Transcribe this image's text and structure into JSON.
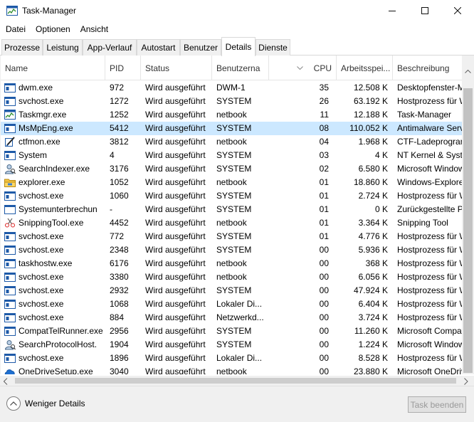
{
  "window": {
    "title": "Task-Manager"
  },
  "menu": [
    {
      "label": "Datei"
    },
    {
      "label": "Optionen"
    },
    {
      "label": "Ansicht"
    }
  ],
  "tabs": [
    {
      "label": "Prozesse"
    },
    {
      "label": "Leistung"
    },
    {
      "label": "App-Verlauf"
    },
    {
      "label": "Autostart"
    },
    {
      "label": "Benutzer"
    },
    {
      "label": "Details",
      "active": true
    },
    {
      "label": "Dienste"
    }
  ],
  "table": {
    "columns": {
      "name": "Name",
      "pid": "PID",
      "status": "Status",
      "user": "Benutzerna",
      "cpu": "CPU",
      "mem": "Arbeitsspei...",
      "desc": "Beschreibung"
    },
    "sort": {
      "column": "cpu",
      "direction": "descending"
    },
    "rows": [
      {
        "icon": "window-icon",
        "name": "dwm.exe",
        "pid": "972",
        "status": "Wird ausgeführt",
        "user": "DWM-1",
        "cpu": "35",
        "mem": "12.508 K",
        "desc": "Desktopfenster-Manager"
      },
      {
        "icon": "window-icon",
        "name": "svchost.exe",
        "pid": "1272",
        "status": "Wird ausgeführt",
        "user": "SYSTEM",
        "cpu": "26",
        "mem": "63.192 K",
        "desc": "Hostprozess für Windows-Dienste"
      },
      {
        "icon": "taskmgr-icon",
        "name": "Taskmgr.exe",
        "pid": "1252",
        "status": "Wird ausgeführt",
        "user": "netbook",
        "cpu": "11",
        "mem": "12.188 K",
        "desc": "Task-Manager"
      },
      {
        "icon": "window-icon",
        "name": "MsMpEng.exe",
        "pid": "5412",
        "status": "Wird ausgeführt",
        "user": "SYSTEM",
        "cpu": "08",
        "mem": "110.052 K",
        "desc": "Antimalware Service Executable",
        "selected": true
      },
      {
        "icon": "pen-icon",
        "name": "ctfmon.exe",
        "pid": "3812",
        "status": "Wird ausgeführt",
        "user": "netbook",
        "cpu": "04",
        "mem": "1.968 K",
        "desc": "CTF-Ladeprogramm"
      },
      {
        "icon": "window-icon",
        "name": "System",
        "pid": "4",
        "status": "Wird ausgeführt",
        "user": "SYSTEM",
        "cpu": "03",
        "mem": "4 K",
        "desc": "NT Kernel & System"
      },
      {
        "icon": "person-icon",
        "name": "SearchIndexer.exe",
        "pid": "3176",
        "status": "Wird ausgeführt",
        "user": "SYSTEM",
        "cpu": "02",
        "mem": "6.580 K",
        "desc": "Microsoft Windows Search-Indexer"
      },
      {
        "icon": "folder-icon",
        "name": "explorer.exe",
        "pid": "1052",
        "status": "Wird ausgeführt",
        "user": "netbook",
        "cpu": "01",
        "mem": "18.860 K",
        "desc": "Windows-Explorer"
      },
      {
        "icon": "window-icon",
        "name": "svchost.exe",
        "pid": "1060",
        "status": "Wird ausgeführt",
        "user": "SYSTEM",
        "cpu": "01",
        "mem": "2.724 K",
        "desc": "Hostprozess für Windows-Dienste"
      },
      {
        "icon": "blank-window-icon",
        "name": "Systemunterbrechun",
        "pid": "-",
        "status": "Wird ausgeführt",
        "user": "SYSTEM",
        "cpu": "01",
        "mem": "0 K",
        "desc": "Zurückgestellte Prozeduraufrufe"
      },
      {
        "icon": "scissors-icon",
        "name": "SnippingTool.exe",
        "pid": "4452",
        "status": "Wird ausgeführt",
        "user": "netbook",
        "cpu": "01",
        "mem": "3.364 K",
        "desc": "Snipping Tool"
      },
      {
        "icon": "window-icon",
        "name": "svchost.exe",
        "pid": "772",
        "status": "Wird ausgeführt",
        "user": "SYSTEM",
        "cpu": "01",
        "mem": "4.776 K",
        "desc": "Hostprozess für Windows-Dienste"
      },
      {
        "icon": "window-icon",
        "name": "svchost.exe",
        "pid": "2348",
        "status": "Wird ausgeführt",
        "user": "SYSTEM",
        "cpu": "00",
        "mem": "5.936 K",
        "desc": "Hostprozess für Windows-Dienste"
      },
      {
        "icon": "window-icon",
        "name": "taskhostw.exe",
        "pid": "6176",
        "status": "Wird ausgeführt",
        "user": "netbook",
        "cpu": "00",
        "mem": "368 K",
        "desc": "Hostprozess für Windows-Aufgaben"
      },
      {
        "icon": "window-icon",
        "name": "svchost.exe",
        "pid": "3380",
        "status": "Wird ausgeführt",
        "user": "netbook",
        "cpu": "00",
        "mem": "6.056 K",
        "desc": "Hostprozess für Windows-Dienste"
      },
      {
        "icon": "window-icon",
        "name": "svchost.exe",
        "pid": "2932",
        "status": "Wird ausgeführt",
        "user": "SYSTEM",
        "cpu": "00",
        "mem": "47.924 K",
        "desc": "Hostprozess für Windows-Dienste"
      },
      {
        "icon": "window-icon",
        "name": "svchost.exe",
        "pid": "1068",
        "status": "Wird ausgeführt",
        "user": "Lokaler Di...",
        "cpu": "00",
        "mem": "6.404 K",
        "desc": "Hostprozess für Windows-Dienste"
      },
      {
        "icon": "window-icon",
        "name": "svchost.exe",
        "pid": "884",
        "status": "Wird ausgeführt",
        "user": "Netzwerkd...",
        "cpu": "00",
        "mem": "3.724 K",
        "desc": "Hostprozess für Windows-Dienste"
      },
      {
        "icon": "window-icon",
        "name": "CompatTelRunner.exe",
        "pid": "2956",
        "status": "Wird ausgeführt",
        "user": "SYSTEM",
        "cpu": "00",
        "mem": "11.260 K",
        "desc": "Microsoft Compatibility Telemetry"
      },
      {
        "icon": "person-icon",
        "name": "SearchProtocolHost.",
        "pid": "1904",
        "status": "Wird ausgeführt",
        "user": "SYSTEM",
        "cpu": "00",
        "mem": "1.224 K",
        "desc": "Microsoft Windows Search Protocol Host"
      },
      {
        "icon": "window-icon",
        "name": "svchost.exe",
        "pid": "1896",
        "status": "Wird ausgeführt",
        "user": "Lokaler Di...",
        "cpu": "00",
        "mem": "8.528 K",
        "desc": "Hostprozess für Windows-Dienste"
      },
      {
        "icon": "cloud-icon",
        "name": "OneDriveSetup.exe",
        "pid": "3040",
        "status": "Wird ausgeführt",
        "user": "netbook",
        "cpu": "00",
        "mem": "23.880 K",
        "desc": "Microsoft OneDrive Setup"
      }
    ]
  },
  "footer": {
    "fewer_details": "Weniger Details",
    "end_task": "Task beenden",
    "end_task_enabled": false
  },
  "colors": {
    "selected_row": "#cce8ff",
    "window_icon": "#1e5aa8"
  }
}
